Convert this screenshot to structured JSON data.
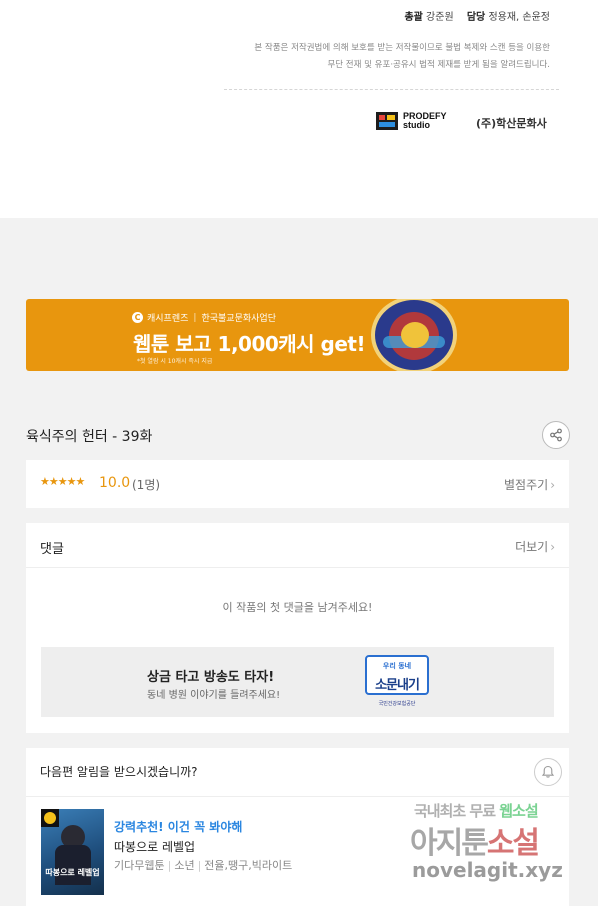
{
  "credits": {
    "supervision_label": "총괄",
    "supervision_name": "강준원",
    "manager_label": "담당",
    "manager_name": "정용재, 손윤정",
    "notice_line1": "본 작품은 저작권법에 의해 보호를 받는 저작물이므로 불법 복제와 스캔 등을 이용한",
    "notice_line2": "무단 전재 및 유포·공유시 법적 제재를 받게 됨을 알려드립니다.",
    "logo_prodefy_1": "PRODEFY",
    "logo_prodefy_2": "studio",
    "logo_haksan": "(주)학산문화사"
  },
  "banner": {
    "brand": "캐시프렌즈",
    "partner": "한국불교문화사업단",
    "headline": "웹툰 보고 1,000캐시 get!",
    "note": "*첫 열람 시 10캐시 즉시 지급",
    "icon": "c-icon",
    "bg_color": "#e8960e"
  },
  "episode": {
    "title": "육식주의 헌터 - 39화",
    "share_icon": "share-icon"
  },
  "rating": {
    "stars": "★★★★★",
    "score": "10.0",
    "count": "(1명)",
    "rate_label": "별점주기"
  },
  "comments": {
    "header": "댓글",
    "more_label": "더보기",
    "empty_message": "이 작품의 첫 댓글을 남겨주세요!",
    "promo_title": "상금 타고 방송도 타자!",
    "promo_subtitle": "동네 병원 이야기를 들려주세요!",
    "promo_badge_line1": "우리 동네",
    "promo_badge_line2": "소문내기",
    "promo_badge_footer": "국민건강보험공단"
  },
  "notify": {
    "question": "다음편 알림을 받으시겠습니까?",
    "bell_icon": "bell-icon"
  },
  "recommendation": {
    "tag": "강력추천! 이건 꼭 봐야해",
    "title": "따봉으로 레벨업",
    "thumb_title": "따봉으로 레벨업",
    "meta_type": "기다무웹툰",
    "meta_audience": "소년",
    "meta_genres": "전율,땡구,빅라이트"
  },
  "watermark": {
    "line1_a": "국내최초 무료 ",
    "line1_b": "웹소설",
    "line2_a": "아지툰",
    "line2_b": "소설",
    "line3": "novelagit.xyz"
  }
}
